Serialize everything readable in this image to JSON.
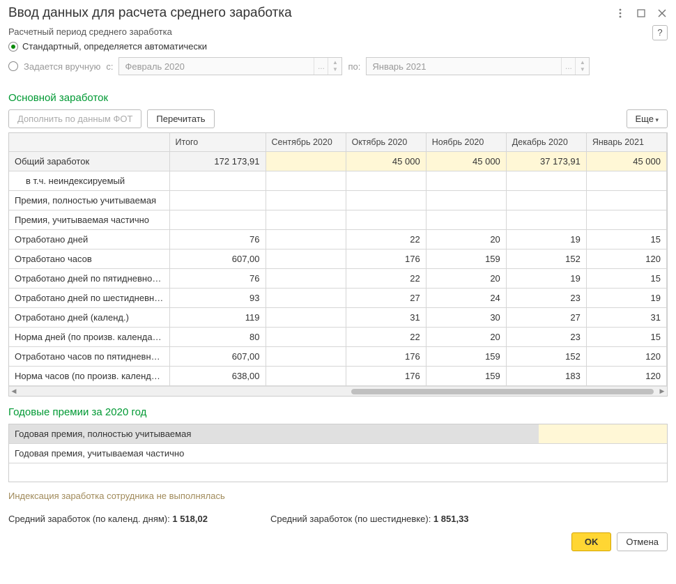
{
  "window": {
    "title": "Ввод данных для расчета среднего заработка"
  },
  "period": {
    "label": "Расчетный период среднего заработка",
    "radio_auto": "Стандартный, определяется автоматически",
    "radio_manual": "Задается вручную",
    "from_label": "с:",
    "from_value": "Февраль 2020",
    "to_label": "по:",
    "to_value": "Январь 2021",
    "help": "?"
  },
  "main_earnings": {
    "title": "Основной заработок",
    "btn_fill": "Дополнить по данным ФОТ",
    "btn_recalc": "Перечитать",
    "btn_more": "Еще"
  },
  "table": {
    "headers": {
      "itogo": "Итого",
      "m0": "Сентябрь 2020",
      "m1": "Октябрь 2020",
      "m2": "Ноябрь 2020",
      "m3": "Декабрь 2020",
      "m4": "Январь 2021"
    },
    "rows": [
      {
        "label": "Общий заработок",
        "itogo": "172 173,91",
        "m0": "",
        "m1": "45 000",
        "m2": "45 000",
        "m3": "37 173,91",
        "m4": "45 000",
        "total": true,
        "hl": true
      },
      {
        "label": "в т.ч. неиндексируемый",
        "itogo": "",
        "m0": "",
        "m1": "",
        "m2": "",
        "m3": "",
        "m4": "",
        "indent": true
      },
      {
        "label": "Премия, полностью учитываемая",
        "itogo": "",
        "m0": "",
        "m1": "",
        "m2": "",
        "m3": "",
        "m4": ""
      },
      {
        "label": "Премия, учитываемая частично",
        "itogo": "",
        "m0": "",
        "m1": "",
        "m2": "",
        "m3": "",
        "m4": ""
      },
      {
        "label": "Отработано дней",
        "itogo": "76",
        "m0": "",
        "m1": "22",
        "m2": "20",
        "m3": "19",
        "m4": "15"
      },
      {
        "label": "Отработано часов",
        "itogo": "607,00",
        "m0": "",
        "m1": "176",
        "m2": "159",
        "m3": "152",
        "m4": "120"
      },
      {
        "label": "Отработано дней по пятидневной неде...",
        "itogo": "76",
        "m0": "",
        "m1": "22",
        "m2": "20",
        "m3": "19",
        "m4": "15"
      },
      {
        "label": "Отработано дней по шестидневной нед...",
        "itogo": "93",
        "m0": "",
        "m1": "27",
        "m2": "24",
        "m3": "23",
        "m4": "19"
      },
      {
        "label": "Отработано дней (календ.)",
        "itogo": "119",
        "m0": "",
        "m1": "31",
        "m2": "30",
        "m3": "27",
        "m4": "31"
      },
      {
        "label": "Норма дней (по произв. календарю)",
        "itogo": "80",
        "m0": "",
        "m1": "22",
        "m2": "20",
        "m3": "23",
        "m4": "15"
      },
      {
        "label": "Отработано часов по пятидневной нед...",
        "itogo": "607,00",
        "m0": "",
        "m1": "176",
        "m2": "159",
        "m3": "152",
        "m4": "120"
      },
      {
        "label": "Норма часов (по произв. календарю)",
        "itogo": "638,00",
        "m0": "",
        "m1": "176",
        "m2": "159",
        "m3": "183",
        "m4": "120"
      }
    ]
  },
  "annual": {
    "title": "Годовые премии за 2020 год",
    "row1": "Годовая премия, полностью учитываемая",
    "row2": "Годовая премия, учитываемая частично"
  },
  "indexation_note": "Индексация заработка сотрудника не выполнялась",
  "avg": {
    "calendar_label": "Средний заработок (по календ. дням): ",
    "calendar_value": "1 518,02",
    "sixday_label": "Средний заработок (по шестидневке): ",
    "sixday_value": "1 851,33"
  },
  "footer": {
    "ok": "OK",
    "cancel": "Отмена"
  }
}
